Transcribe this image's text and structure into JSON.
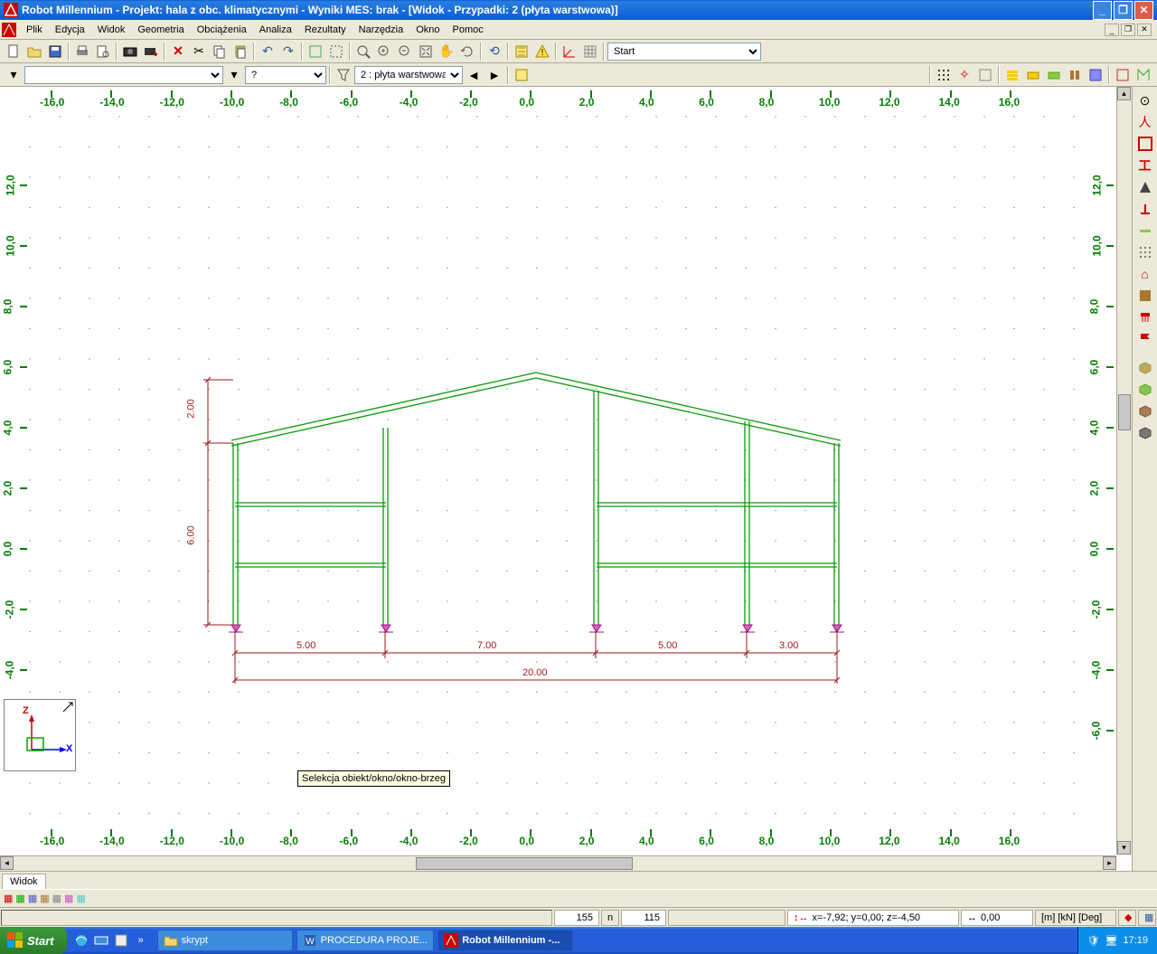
{
  "title": "Robot Millennium - Projekt: hala z obc. klimatycznymi - Wyniki MES: brak - [Widok - Przypadki: 2 (płyta warstwowa)]",
  "menu": {
    "plik": "Plik",
    "edycja": "Edycja",
    "widok": "Widok",
    "geometria": "Geometria",
    "obc": "Obciążenia",
    "analiza": "Analiza",
    "rezultaty": "Rezultaty",
    "narz": "Narzędzia",
    "okno": "Okno",
    "pomoc": "Pomoc"
  },
  "combo_case": "2 : płyta warstwowa",
  "combo_layout": "Start",
  "combo_sel_val": "?",
  "tooltip": "Selekcja obiekt/okno/okno-brzeg",
  "ruler_x": [
    "-16,0",
    "-14,0",
    "-12,0",
    "-10,0",
    "-8,0",
    "-6,0",
    "-4,0",
    "-2,0",
    "0,0",
    "2,0",
    "4,0",
    "6,0",
    "8,0",
    "10,0",
    "12,0",
    "14,0",
    "16,0"
  ],
  "ruler_y": [
    "12,0",
    "10,0",
    "8,0",
    "6,0",
    "4,0",
    "2,0",
    "0,0",
    "-2,0",
    "-4,0",
    "-6,0"
  ],
  "dims": {
    "h1": "2.00",
    "h2": "6.00",
    "s1": "5.00",
    "s2": "7.00",
    "s3": "5.00",
    "s4": "3.00",
    "total": "20.00"
  },
  "tab": "Widok",
  "status": {
    "n1": "155",
    "nlabel": "n",
    "n2": "115",
    "coords": "x=-7,92; y=0,00; z=-4,50",
    "dist": "0,00",
    "units": "[m] [kN] [Deg]"
  },
  "taskbar": {
    "start": "Start",
    "skrypt": "skrypt",
    "proc": "PROCEDURA PROJE...",
    "robot": "Robot Millennium -...",
    "time": "17:19"
  },
  "axis": {
    "z": "Z",
    "x": "X"
  }
}
